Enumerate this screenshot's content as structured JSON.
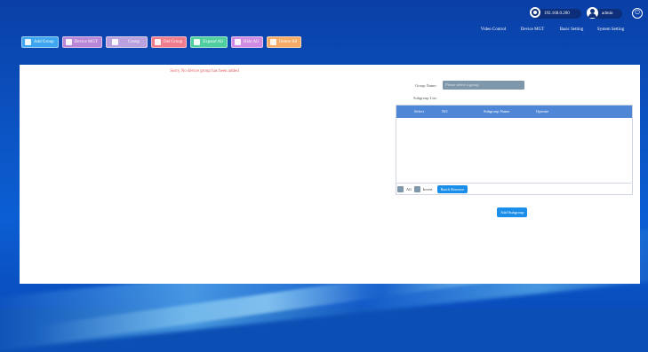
{
  "header": {
    "ip": "192.168.0.200",
    "user": "admin",
    "nav": [
      "Video Control",
      "Device MGT",
      "Basic Setting",
      "System Setting"
    ]
  },
  "toolbar": [
    {
      "label": "Add Group",
      "color": "#3ea6f0",
      "icon": "add-group-icon"
    },
    {
      "label": "Device MGT",
      "color": "#b987d8",
      "icon": "device-icon"
    },
    {
      "label": "Group",
      "color": "#b9a1de",
      "icon": "group-icon"
    },
    {
      "label": "Del Group",
      "color": "#ef7d8e",
      "icon": "delete-group-icon"
    },
    {
      "label": "Expand All",
      "color": "#4fcfa0",
      "icon": "expand-icon"
    },
    {
      "label": "Hide All",
      "color": "#d08be2",
      "icon": "collapse-icon"
    },
    {
      "label": "Delete All",
      "color": "#f6ac67",
      "icon": "delete-all-icon"
    }
  ],
  "left": {
    "empty_message": "Sorry No device group has been added"
  },
  "right": {
    "group_name_label": "Group Name:",
    "group_name_placeholder": "Please select a group",
    "subgroup_list_label": "Subgroup List:",
    "columns": [
      "Select",
      "NO.",
      "Subgroup Name",
      "Operate"
    ],
    "all_label": "All",
    "invert_label": "Invert",
    "batch_remove": "Batch Remove",
    "add_subgroup": "Add Subgroup"
  }
}
